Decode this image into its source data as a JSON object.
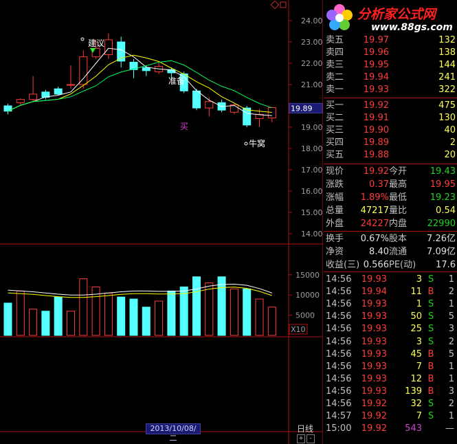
{
  "chart": {
    "price_ticks": [
      "24.00",
      "23.00",
      "22.00",
      "21.00",
      "20.00",
      "19.00",
      "18.00",
      "17.00",
      "16.00",
      "15.00",
      "14.00"
    ],
    "current_price_tag": "19.89",
    "volume_ticks": [
      "15000",
      "10000",
      "5000"
    ],
    "volume_unit": "X10",
    "annotations": {
      "jianyi": "建议",
      "zhunbei": "准备",
      "mai": "买",
      "niuwo": "牛窝"
    },
    "date_label": "2013/10/08/二",
    "period": "日线",
    "controls": [
      "+",
      "-"
    ]
  },
  "logo": {
    "title": "分析家公式网",
    "url": "www.88gs.com"
  },
  "order_book": {
    "asks": [
      {
        "label": "卖五",
        "price": "19.97",
        "vol": "132"
      },
      {
        "label": "卖四",
        "price": "19.96",
        "vol": "138"
      },
      {
        "label": "卖三",
        "price": "19.95",
        "vol": "144"
      },
      {
        "label": "卖二",
        "price": "19.94",
        "vol": "241"
      },
      {
        "label": "卖一",
        "price": "19.93",
        "vol": "322"
      }
    ],
    "bids": [
      {
        "label": "买一",
        "price": "19.92",
        "vol": "475"
      },
      {
        "label": "买二",
        "price": "19.91",
        "vol": "130"
      },
      {
        "label": "买三",
        "price": "19.90",
        "vol": "40"
      },
      {
        "label": "买四",
        "price": "19.89",
        "vol": "2"
      },
      {
        "label": "买五",
        "price": "19.88",
        "vol": "20"
      }
    ]
  },
  "quote": [
    {
      "l1": "现价",
      "v1": "19.92",
      "l2": "今开",
      "v2": "19.43"
    },
    {
      "l1": "涨跌",
      "v1": "0.37",
      "l2": "最高",
      "v2": "19.95"
    },
    {
      "l1": "涨幅",
      "v1": "1.89%",
      "l2": "最低",
      "v2": "19.23"
    },
    {
      "l1": "总量",
      "v1": "47217",
      "l2": "量比",
      "v2": "0.54"
    },
    {
      "l1": "外盘",
      "v1": "24227",
      "l2": "内盘",
      "v2": "22990"
    }
  ],
  "finance": [
    {
      "l1": "换手",
      "v1": "0.67%",
      "l2": "股本",
      "v2": "7.26亿"
    },
    {
      "l1": "净资",
      "v1": "8.40",
      "l2": "流通",
      "v2": "7.09亿"
    },
    {
      "l1": "收益(三)",
      "v1": "0.566",
      "l2": "PE(动)",
      "v2": "17.6"
    }
  ],
  "ticks": [
    {
      "time": "14:56",
      "price": "19.93",
      "vol": "3",
      "bs": "S",
      "cnt": "1"
    },
    {
      "time": "14:56",
      "price": "19.94",
      "vol": "11",
      "bs": "B",
      "cnt": "2"
    },
    {
      "time": "14:56",
      "price": "19.93",
      "vol": "1",
      "bs": "S",
      "cnt": "1"
    },
    {
      "time": "14:56",
      "price": "19.93",
      "vol": "50",
      "bs": "S",
      "cnt": "5"
    },
    {
      "time": "14:56",
      "price": "19.93",
      "vol": "25",
      "bs": "S",
      "cnt": "3"
    },
    {
      "time": "14:56",
      "price": "19.93",
      "vol": "3",
      "bs": "S",
      "cnt": "2"
    },
    {
      "time": "14:56",
      "price": "19.93",
      "vol": "45",
      "bs": "B",
      "cnt": "5"
    },
    {
      "time": "14:56",
      "price": "19.93",
      "vol": "7",
      "bs": "B",
      "cnt": "1"
    },
    {
      "time": "14:56",
      "price": "19.93",
      "vol": "12",
      "bs": "B",
      "cnt": "1"
    },
    {
      "time": "14:56",
      "price": "19.93",
      "vol": "139",
      "bs": "B",
      "cnt": "3"
    },
    {
      "time": "14:56",
      "price": "19.92",
      "vol": "32",
      "bs": "S",
      "cnt": "2"
    },
    {
      "time": "14:57",
      "price": "19.92",
      "vol": "7",
      "bs": "S",
      "cnt": "1"
    },
    {
      "time": "15:00",
      "price": "19.92",
      "vol": "543",
      "bs": "",
      "cnt": "—"
    }
  ],
  "colors": {
    "up": "#ff3c3c",
    "down": "#54ffff",
    "grid": "#b01010",
    "ma_white": "#ffffff",
    "ma_yellow": "#ffff00",
    "ma_green": "#00ff60"
  },
  "candles": [
    {
      "o": 20.0,
      "c": 19.75,
      "h": 20.1,
      "l": 19.6
    },
    {
      "o": 20.15,
      "c": 20.3,
      "h": 20.35,
      "l": 20.05
    },
    {
      "o": 20.3,
      "c": 20.55,
      "h": 21.4,
      "l": 20.2
    },
    {
      "o": 20.65,
      "c": 20.4,
      "h": 20.75,
      "l": 20.3
    },
    {
      "o": 20.8,
      "c": 20.55,
      "h": 20.9,
      "l": 20.5
    },
    {
      "o": 21.0,
      "c": 21.0,
      "h": 21.9,
      "l": 20.8
    },
    {
      "o": 21.0,
      "c": 22.3,
      "h": 22.6,
      "l": 20.8
    },
    {
      "o": 22.3,
      "c": 22.7,
      "h": 23.1,
      "l": 22.2
    },
    {
      "o": 22.4,
      "c": 23.1,
      "h": 23.4,
      "l": 22.2
    },
    {
      "o": 23.0,
      "c": 22.1,
      "h": 23.25,
      "l": 21.8
    },
    {
      "o": 22.05,
      "c": 21.7,
      "h": 22.2,
      "l": 21.3
    },
    {
      "o": 21.8,
      "c": 21.65,
      "h": 21.9,
      "l": 21.4
    },
    {
      "o": 21.6,
      "c": 21.85,
      "h": 22.1,
      "l": 21.5
    },
    {
      "o": 21.7,
      "c": 21.55,
      "h": 21.8,
      "l": 21.3
    },
    {
      "o": 21.5,
      "c": 20.7,
      "h": 21.6,
      "l": 20.6
    },
    {
      "o": 20.7,
      "c": 19.9,
      "h": 20.8,
      "l": 19.8
    },
    {
      "o": 19.9,
      "c": 20.2,
      "h": 20.4,
      "l": 19.5
    },
    {
      "o": 20.15,
      "c": 19.8,
      "h": 20.3,
      "l": 19.7
    },
    {
      "o": 19.7,
      "c": 20.05,
      "h": 20.1,
      "l": 19.6
    },
    {
      "o": 19.9,
      "c": 19.1,
      "h": 20.0,
      "l": 19.0
    },
    {
      "o": 19.4,
      "c": 19.6,
      "h": 19.85,
      "l": 19.0
    },
    {
      "o": 19.43,
      "c": 19.92,
      "h": 19.95,
      "l": 19.23
    }
  ],
  "volumes": [
    8000,
    11000,
    6500,
    6000,
    9500,
    6000,
    14000,
    12000,
    10500,
    9500,
    9000,
    7000,
    8500,
    11000,
    12000,
    14500,
    13000,
    14500,
    11500,
    11500,
    9000,
    7000
  ],
  "vol_ma": [
    11200,
    11000,
    10800,
    10500,
    10200,
    10000,
    10000,
    10200,
    10500,
    10800,
    11000,
    11000,
    10900,
    10900,
    11000,
    11500,
    12200,
    12600,
    12700,
    12400,
    11600,
    10500
  ]
}
